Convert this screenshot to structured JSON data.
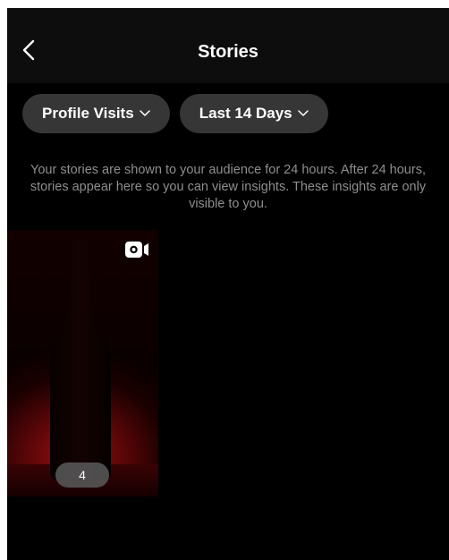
{
  "header": {
    "title": "Stories",
    "back_icon": "chevron-left-icon"
  },
  "filters": [
    {
      "label": "Profile Visits",
      "icon": "chevron-down-icon"
    },
    {
      "label": "Last 14 Days",
      "icon": "chevron-down-icon"
    }
  ],
  "notice": "Your stories are shown to your audience for 24 hours. After 24 hours, stories appear here so you can view insights. These insights are only visible to you.",
  "stories": [
    {
      "metric_value": "4",
      "media_icon": "video-icon"
    }
  ],
  "colors": {
    "background": "#000000",
    "header_background": "#0d0d0d",
    "pill_background": "#363636",
    "secondary_text": "#8e8e8e",
    "thumbnail_accent": "#9a0f10"
  }
}
